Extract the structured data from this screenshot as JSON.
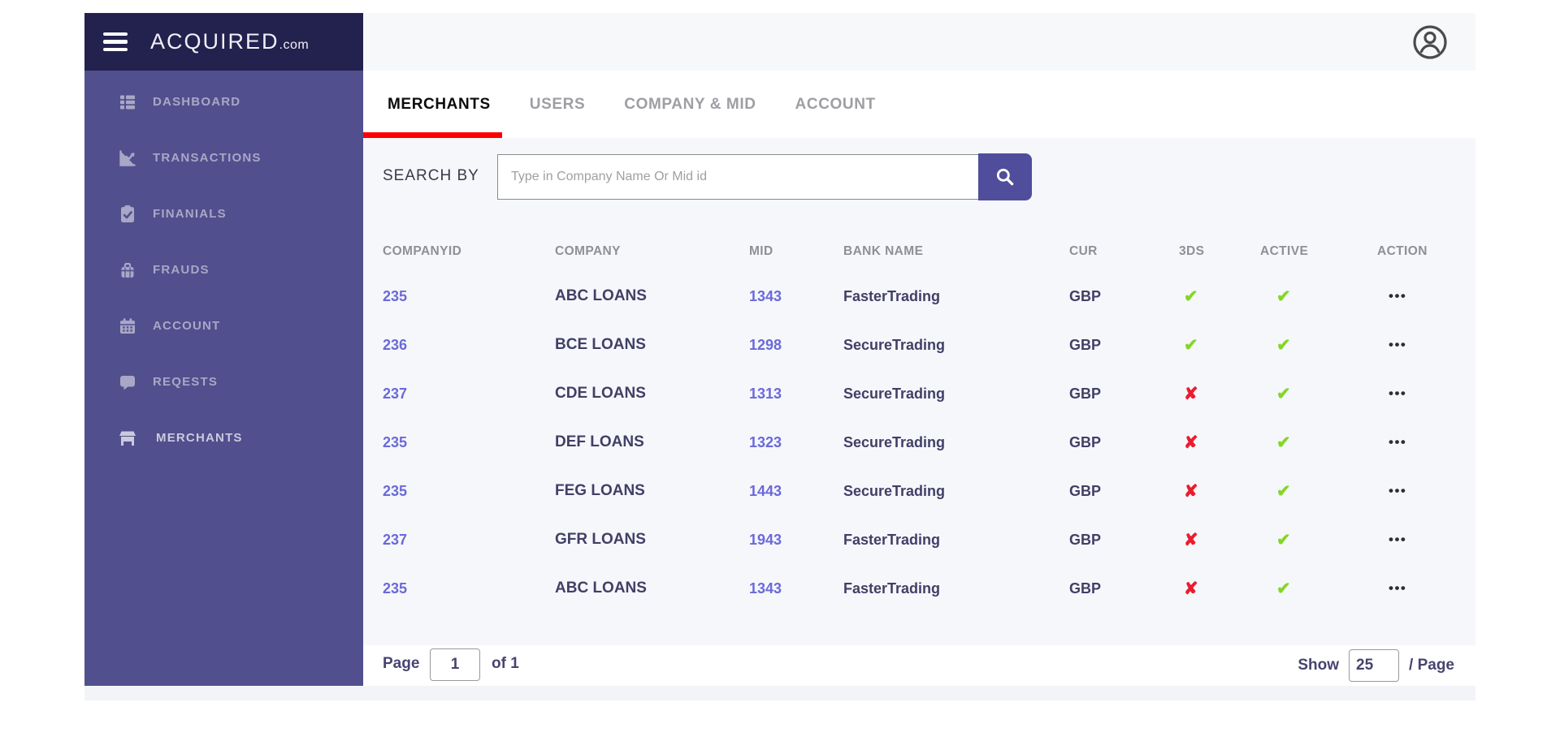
{
  "brand": {
    "name": "ACQUIRED",
    "suffix": ".com"
  },
  "sidebar": {
    "items": [
      {
        "label": "DASHBOARD",
        "icon": "dashboard-icon"
      },
      {
        "label": "TRANSACTIONS",
        "icon": "transactions-chart-icon"
      },
      {
        "label": "FINANIALS",
        "icon": "clipboard-check-icon"
      },
      {
        "label": "FRAUDS",
        "icon": "briefcase-icon"
      },
      {
        "label": "ACCOUNT",
        "icon": "calendar-icon"
      },
      {
        "label": "REQESTS",
        "icon": "chat-bubble-icon"
      },
      {
        "label": "MERCHANTS",
        "icon": "storefront-icon"
      }
    ]
  },
  "tabs": [
    {
      "label": "MERCHANTS",
      "active": true
    },
    {
      "label": "USERS",
      "active": false
    },
    {
      "label": "COMPANY & MID",
      "active": false
    },
    {
      "label": "ACCOUNT",
      "active": false
    }
  ],
  "search": {
    "label": "SEARCH BY",
    "placeholder": "Type in Company Name Or Mid id"
  },
  "table": {
    "columns": [
      "COMPANYID",
      "COMPANY",
      "MID",
      "BANK NAME",
      "CUR",
      "3DS",
      "ACTIVE",
      "ACTION"
    ],
    "rows": [
      {
        "company_id": "235",
        "company": "ABC LOANS",
        "mid": "1343",
        "bank": "FasterTrading",
        "cur": "GBP",
        "tds": "yes",
        "active": "yes"
      },
      {
        "company_id": "236",
        "company": "BCE LOANS",
        "mid": "1298",
        "bank": "SecureTrading",
        "cur": "GBP",
        "tds": "yes",
        "active": "yes"
      },
      {
        "company_id": "237",
        "company": "CDE LOANS",
        "mid": "1313",
        "bank": "SecureTrading",
        "cur": "GBP",
        "tds": "no",
        "active": "yes"
      },
      {
        "company_id": "235",
        "company": "DEF LOANS",
        "mid": "1323",
        "bank": "SecureTrading",
        "cur": "GBP",
        "tds": "no",
        "active": "yes"
      },
      {
        "company_id": "235",
        "company": "FEG LOANS",
        "mid": "1443",
        "bank": "SecureTrading",
        "cur": "GBP",
        "tds": "no",
        "active": "yes"
      },
      {
        "company_id": "237",
        "company": "GFR LOANS",
        "mid": "1943",
        "bank": "FasterTrading",
        "cur": "GBP",
        "tds": "no",
        "active": "yes"
      },
      {
        "company_id": "235",
        "company": "ABC LOANS",
        "mid": "1343",
        "bank": "FasterTrading",
        "cur": "GBP",
        "tds": "no",
        "active": "yes"
      }
    ]
  },
  "pagination": {
    "page_label": "Page",
    "page_value": "1",
    "of_label": "of 1",
    "show_label": "Show",
    "show_value": "25",
    "per_page_label": "/  Page"
  },
  "colors": {
    "sidebar": "#514f8d",
    "sidebar_header": "#23214e",
    "accent_purple": "#4f4d9c",
    "tab_underline": "#fb0000",
    "link_purple": "#6b69da",
    "text_navy": "#413f66",
    "check_green": "#84d626",
    "cross_red": "#ea1d2d",
    "content_bg": "#f6f7fb"
  }
}
